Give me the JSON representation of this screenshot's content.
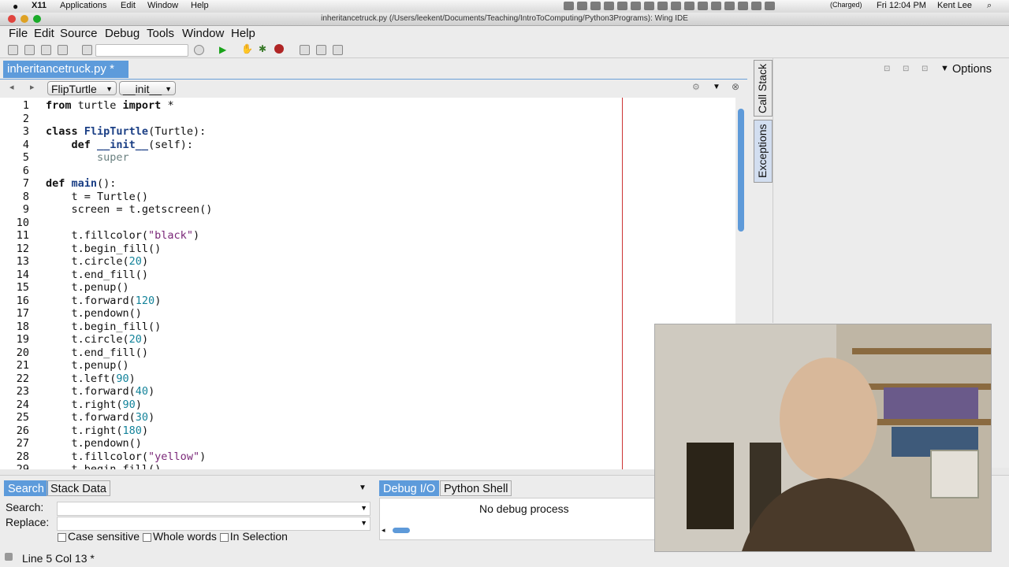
{
  "macbar": {
    "app": "X11",
    "menus": [
      "Applications",
      "Edit",
      "Window",
      "Help"
    ],
    "battery": "(Charged)",
    "clock": "Fri 12:04 PM",
    "user": "Kent Lee"
  },
  "window": {
    "title": "inheritancetruck.py (/Users/leekent/Documents/Teaching/IntroToComputing/Python3Programs): Wing IDE"
  },
  "menu": [
    "File",
    "Edit",
    "Source",
    "Debug",
    "Tools",
    "Window",
    "Help"
  ],
  "editor": {
    "tab": "inheritancetruck.py *",
    "class_combo": "FlipTurtle",
    "method_combo": "__init__",
    "line_numbers": [
      "1",
      "2",
      "3",
      "4",
      "5",
      "6",
      "7",
      "8",
      "9",
      "10",
      "11",
      "12",
      "13",
      "14",
      "15",
      "16",
      "17",
      "18",
      "19",
      "20",
      "21",
      "22",
      "23",
      "24",
      "25",
      "26",
      "27",
      "28",
      "29"
    ]
  },
  "right_panel": {
    "tabs": [
      "Call Stack",
      "Exceptions"
    ],
    "options_label": "Options"
  },
  "bottom": {
    "left_tabs": [
      "Search",
      "Stack Data"
    ],
    "search_label": "Search:",
    "replace_label": "Replace:",
    "options": [
      "Case sensitive",
      "Whole words",
      "In Selection"
    ],
    "right_tabs": [
      "Debug I/O",
      "Python Shell"
    ],
    "debug_status": "No debug process"
  },
  "status": {
    "position": "Line 5 Col 13 *"
  },
  "colors": {
    "selection_blue": "#5d9bdb",
    "keyword_blue": "#1b3f85",
    "number_teal": "#13839a",
    "string_purple": "#7a2778",
    "edge_line": "#cc3333"
  }
}
